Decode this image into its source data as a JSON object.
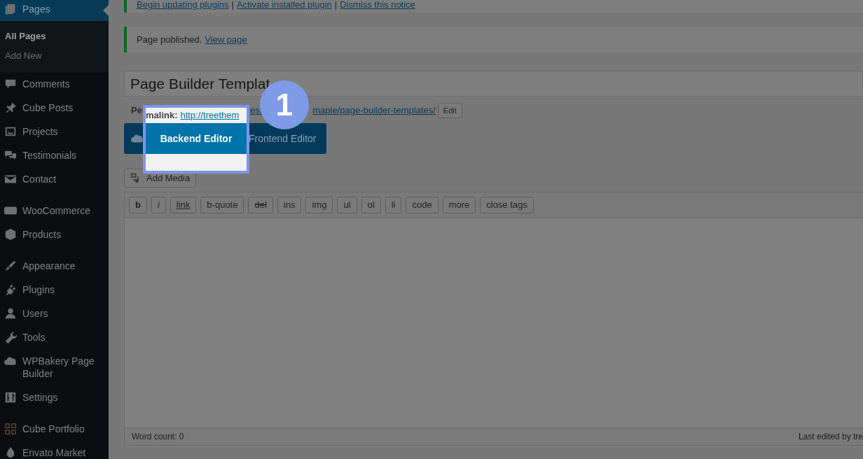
{
  "sidebar": {
    "groups": [
      {
        "items": [
          {
            "label": "Pages",
            "selected": true,
            "children": [
              {
                "label": "All Pages",
                "selected": true
              },
              {
                "label": "Add New",
                "selected": false
              }
            ]
          },
          {
            "label": "Comments",
            "selected": false
          },
          {
            "label": "Cube Posts",
            "selected": false
          },
          {
            "label": "Projects",
            "selected": false
          },
          {
            "label": "Testimonials",
            "selected": false
          },
          {
            "label": "Contact",
            "selected": false
          }
        ]
      },
      {
        "items": [
          {
            "label": "WooCommerce",
            "selected": false
          },
          {
            "label": "Products",
            "selected": false
          }
        ]
      },
      {
        "items": [
          {
            "label": "Appearance",
            "selected": false
          },
          {
            "label": "Plugins",
            "selected": false
          },
          {
            "label": "Users",
            "selected": false
          },
          {
            "label": "Tools",
            "selected": false
          },
          {
            "label": "WPBakery Page Builder",
            "selected": false
          },
          {
            "label": "Settings",
            "selected": false
          }
        ]
      },
      {
        "items": [
          {
            "label": "Cube Portfolio",
            "selected": false
          },
          {
            "label": "Envato Market",
            "selected": false
          }
        ]
      }
    ]
  },
  "notices": [
    {
      "parts": [
        {
          "kind": "link",
          "text": "Begin updating plugins"
        },
        {
          "kind": "sep",
          "text": "|"
        },
        {
          "kind": "link",
          "text": "Activate installed plugin"
        },
        {
          "kind": "sep",
          "text": "|"
        },
        {
          "kind": "link",
          "text": "Dismiss this notice"
        }
      ]
    },
    {
      "parts": [
        {
          "kind": "text",
          "text": "Page published."
        },
        {
          "kind": "link",
          "text": "View page"
        }
      ]
    }
  ],
  "title_field": {
    "value": "Page Builder Templat"
  },
  "permalink": {
    "label": "Pe",
    "link_parts": [
      "es.",
      "maple/page-builder-templates/"
    ],
    "edit_button": "Edit"
  },
  "builder_bar": {
    "frontend_button": "Frontend Editor"
  },
  "add_media": "Add Media",
  "quicktags": [
    {
      "label": "b",
      "kind": "bold"
    },
    {
      "label": "i",
      "kind": "italic"
    },
    {
      "label": "link",
      "kind": "underline"
    },
    {
      "label": "b-quote",
      "kind": "plain"
    },
    {
      "label": "del",
      "kind": "strike"
    },
    {
      "label": "ins",
      "kind": "plain"
    },
    {
      "label": "img",
      "kind": "plain"
    },
    {
      "label": "ul",
      "kind": "plain"
    },
    {
      "label": "ol",
      "kind": "plain"
    },
    {
      "label": "li",
      "kind": "plain"
    },
    {
      "label": "code",
      "kind": "plain"
    },
    {
      "label": "more",
      "kind": "plain"
    },
    {
      "label": "close tags",
      "kind": "plain"
    }
  ],
  "editor_footer": {
    "word_count": "Word count: 0",
    "last_edited": "Last edited by tre"
  },
  "spotlight": {
    "permalink_label": "malink:",
    "permalink_link": "http://treethem",
    "button": "Backend Editor"
  },
  "step_badge": "1"
}
